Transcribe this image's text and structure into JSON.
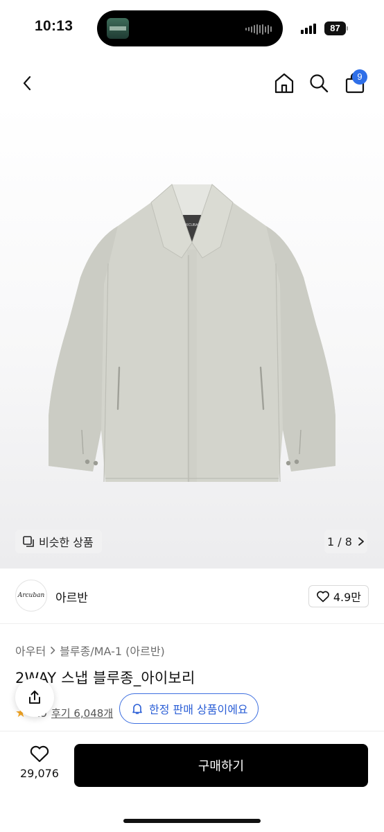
{
  "status_bar": {
    "time": "10:13",
    "battery": "87"
  },
  "nav": {
    "cart_count": "9"
  },
  "gallery": {
    "similar_label": "비슷한 상품",
    "page": "1 / 8",
    "jacket_logo_text": "ARCUBAN"
  },
  "brand": {
    "logo_text": "Arcuban",
    "name": "아르반",
    "likes": "4.9만"
  },
  "product": {
    "breadcrumb": [
      "아우터",
      "블루종/MA-1 (아르반)"
    ],
    "title": "2WAY 스냅 블루종_아이보리",
    "rating": "4.9",
    "reviews": "후기 6,048개"
  },
  "toast": {
    "text": "한정 판매 상품이에요"
  },
  "bottom": {
    "wish_count": "29,076",
    "buy_label": "구매하기"
  },
  "colors": {
    "accent_blue": "#2f6fe8",
    "buy_button": "#000000",
    "star": "#f5a623",
    "jacket": "#d3d4cc"
  }
}
